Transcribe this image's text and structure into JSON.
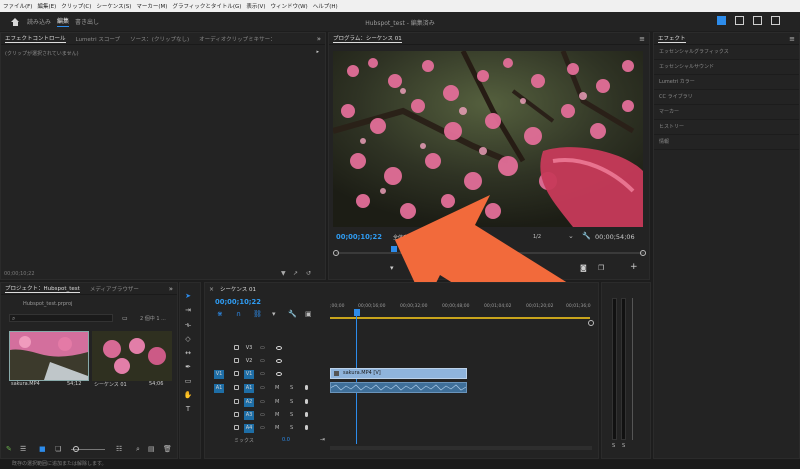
{
  "menu": [
    "ファイル(F)",
    "編集(E)",
    "クリップ(C)",
    "シーケンス(S)",
    "マーカー(M)",
    "グラフィックとタイトル(G)",
    "表示(V)",
    "ウィンドウ(W)",
    "ヘルプ(H)"
  ],
  "header": {
    "tabs": [
      "読み込み",
      "編集",
      "書き出し"
    ],
    "active_tab": "編集",
    "title": "Hubspot_test - 編集済み"
  },
  "effect_controls": {
    "tabs": [
      "エフェクトコントロール",
      "Lumetri スコープ",
      "ソース：(クリップなし)",
      "オーディオクリップミキサー："
    ],
    "no_clip": "(クリップが選択されていません)",
    "timecode": "00;00;10;22"
  },
  "program": {
    "tab": "プログラム：シーケンス 01",
    "timecode": "00;00;10;22",
    "fit": "全体表示",
    "quality": "1/2",
    "duration": "00;00;54;06"
  },
  "effects_panel": {
    "title": "エフェクト",
    "items": [
      "エッセンシャルグラフィックス",
      "エッセンシャルサウンド",
      "Lumetri カラー",
      "CC ライブラリ",
      "マーカー",
      "ヒストリー",
      "情報"
    ]
  },
  "project": {
    "tabs": [
      "プロジェクト：Hubspot_test",
      "メディアブラウザー"
    ],
    "file": "Hubspot_test.prproj",
    "selection": "2 個中 1 ...",
    "items": [
      {
        "name": "sakura.MP4",
        "duration": "54;12"
      },
      {
        "name": "シーケンス 01",
        "duration": "54;06"
      }
    ]
  },
  "timeline": {
    "tab": "シーケンス 01",
    "timecode": "00;00;10;22",
    "ruler": [
      ";00;00",
      "00;00;16;00",
      "00;00;32;00",
      "00;00;48;00",
      "00;01;04;02",
      "00;01;20;02",
      "00;01;36;0"
    ],
    "video_tracks": [
      "V3",
      "V2",
      "V1"
    ],
    "audio_tracks": [
      "A1",
      "A2",
      "A3",
      "A4"
    ],
    "source_v": "V1",
    "source_a": "A1",
    "clip_label": "sakura.MP4 [V]",
    "mix_label": "ミックス",
    "mix_value": "0.0",
    "m": "M",
    "s": "S"
  },
  "meter": {
    "labels": [
      "S",
      "S"
    ]
  },
  "status": "既存の選択範囲に追加または解除します。",
  "colors": {
    "accent": "#2d8ceb",
    "clip": "#8fb4dc",
    "arrow": "#f26a3b"
  }
}
